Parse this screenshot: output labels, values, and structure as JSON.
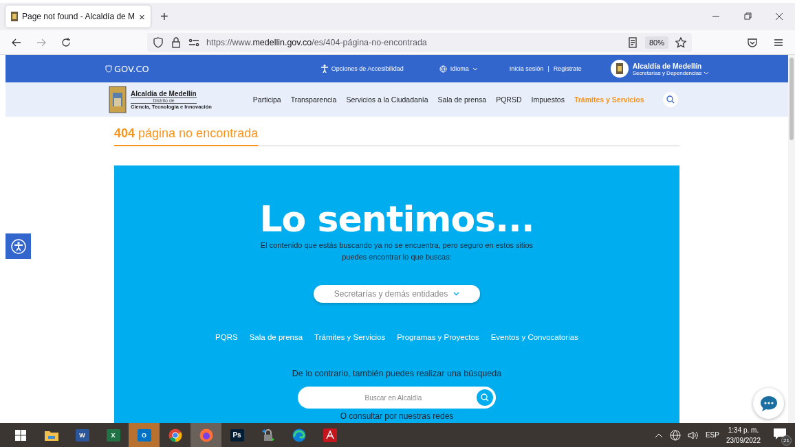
{
  "browser": {
    "tabs": [
      {
        "title": "Page not found - Alcaldía de M",
        "close": "×",
        "selected": true
      }
    ],
    "new_tab": "+",
    "url": "https://www.**medellin.gov.co**/es/404-página-no-encontrada",
    "zoom": "80%"
  },
  "gov_bar": {
    "logo": "GOV.CO",
    "accessibility": "Opciones de Accesibilidad",
    "language": "Idioma",
    "login": "Inicia sesión",
    "separator": "|",
    "register": "Registrate",
    "entity_title": "Alcaldía de Medellín",
    "entity_subtitle": "Secretarías y Dependencias"
  },
  "header": {
    "logo_title": "Alcaldía de Medellín",
    "logo_subtitle": "Distrito de",
    "logo_tagline": "Ciencia, Tecnología e Innovación",
    "nav": [
      {
        "label": "Participa",
        "selected": false
      },
      {
        "label": "Transparencia",
        "selected": false
      },
      {
        "label": "Servicios a la Ciudadanía",
        "selected": false
      },
      {
        "label": "Sala de prensa",
        "selected": false
      },
      {
        "label": "PQRSD",
        "selected": false
      },
      {
        "label": "Impuestos",
        "selected": false
      },
      {
        "label": "Trámites y Servicios",
        "selected": true
      }
    ]
  },
  "page_title": "**404** página no encontrada",
  "hero": {
    "heading": "Lo sentimos...",
    "message": "El contenido que estás buscando ya no se encuentra, pero seguro en estos sitios puedes encontrar lo que buscas:",
    "dropdown": "Secretarías y demás entidades",
    "links": [
      "PQRS",
      "Sala de prensa",
      "Trámites y Servicios",
      "Programas y Proyectos",
      "Eventos y Convocatorias"
    ],
    "search_prompt": "De lo contrario, también puedes realizar una búsqueda",
    "search_placeholder": "Buscar en Alcaldía",
    "social_prompt": "O consultar por nuestras redes"
  },
  "taskbar": {
    "apps": [
      {
        "kind": "start",
        "active": false,
        "flashing": false
      },
      {
        "kind": "explorer",
        "active": false,
        "flashing": false
      },
      {
        "kind": "word",
        "label": "W",
        "active": false,
        "flashing": false
      },
      {
        "kind": "excel",
        "label": "X",
        "active": false,
        "flashing": false
      },
      {
        "kind": "outlook",
        "label": "O",
        "active": false,
        "flashing": true
      },
      {
        "kind": "chrome",
        "active": false,
        "flashing": false
      },
      {
        "kind": "firefox",
        "active": true,
        "flashing": false
      },
      {
        "kind": "photoshop",
        "label": "Ps",
        "active": false,
        "flashing": false
      },
      {
        "kind": "vpn",
        "active": false,
        "flashing": false
      },
      {
        "kind": "edge",
        "active": false,
        "flashing": false
      },
      {
        "kind": "acrobat",
        "active": false,
        "flashing": false
      }
    ],
    "language": "ESP",
    "time": "1:34 p. m.",
    "date": "23/09/2022",
    "notifications": "21"
  }
}
